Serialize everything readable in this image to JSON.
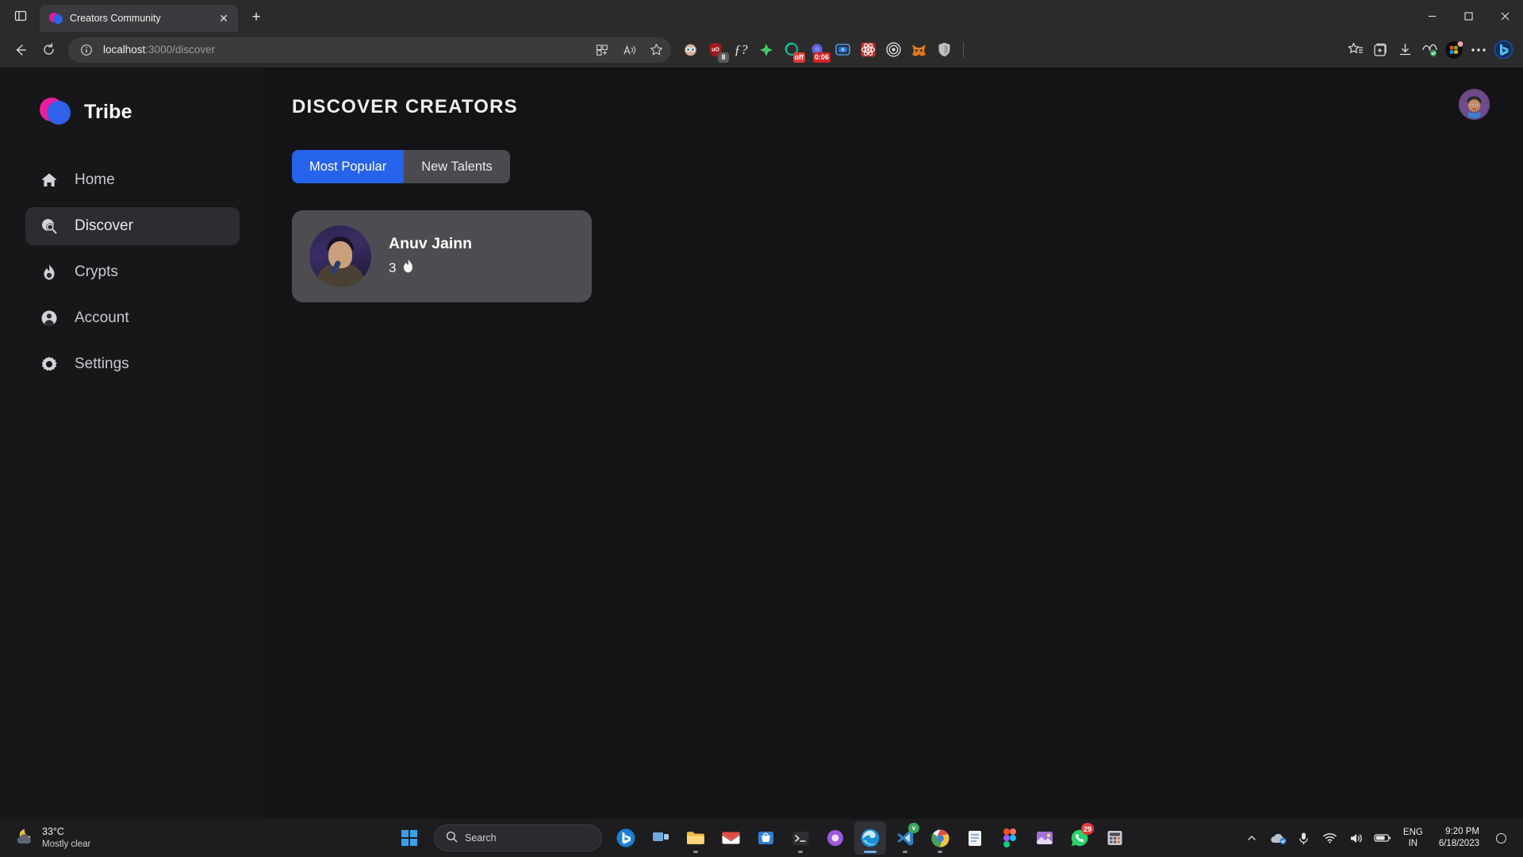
{
  "browser": {
    "tab": {
      "title": "Creators Community",
      "favicon": "tribe-logo-icon",
      "close_label": "✕"
    },
    "new_tab_label": "+",
    "sidebar_toggle": "tab-actions-icon",
    "window_controls": {
      "minimize": "−",
      "maximize": "☐",
      "close": "✕"
    },
    "nav": {
      "back": "←",
      "refresh": "↻"
    },
    "address": {
      "host": "localhost",
      "path": ":3000/discover",
      "info_icon": "info-icon"
    },
    "omnibox_actions": [
      {
        "name": "split-screen-icon",
        "glyph": "⊞"
      },
      {
        "name": "read-aloud-icon",
        "glyph": "A"
      },
      {
        "name": "favorite-star-icon",
        "glyph": "☆"
      }
    ],
    "extensions": [
      {
        "name": "grammarly-extension",
        "glyph": "◉",
        "color": "#d7b49a",
        "badge": "",
        "badge_color": ""
      },
      {
        "name": "ublock-origin-extension",
        "glyph": "uO",
        "color": "#a01b1b",
        "badge": "8",
        "badge_color": "#5a5a5a"
      },
      {
        "name": "wolfram-extension",
        "glyph": "ƒ?",
        "color": "#e8e8e8",
        "badge": "",
        "badge_color": ""
      },
      {
        "name": "color-picker-extension",
        "glyph": "✸",
        "color": "#6fc3e8",
        "badge": "",
        "badge_color": ""
      },
      {
        "name": "screen-recorder-extension",
        "glyph": "◔",
        "color": "#1ba98a",
        "badge": "off",
        "badge_color": "#e03a3a"
      },
      {
        "name": "loom-extension",
        "glyph": "◕",
        "color": "#5b5fd8",
        "badge": "0:06",
        "badge_color": "#d42323"
      },
      {
        "name": "video-downloader-extension",
        "glyph": "▣",
        "color": "#3b82f6",
        "badge": "",
        "badge_color": ""
      },
      {
        "name": "react-devtools-extension",
        "glyph": "⚛",
        "color": "#c03030",
        "badge": "",
        "badge_color": ""
      },
      {
        "name": "target-extension",
        "glyph": "◎",
        "color": "#dcdcdc",
        "badge": "",
        "badge_color": ""
      },
      {
        "name": "metamask-extension",
        "glyph": "🦊",
        "color": "#e2761b",
        "badge": "",
        "badge_color": ""
      },
      {
        "name": "shield-privacy-extension",
        "glyph": "⛨",
        "color": "#bfbfbf",
        "badge": "",
        "badge_color": ""
      }
    ],
    "toolbar_right": [
      {
        "name": "favorites-icon",
        "glyph": "☆"
      },
      {
        "name": "collections-icon",
        "glyph": "❐"
      },
      {
        "name": "downloads-icon",
        "glyph": "↓"
      },
      {
        "name": "browser-essentials-icon",
        "glyph": "♡"
      },
      {
        "name": "microsoft-rewards-icon",
        "glyph": "⊞"
      },
      {
        "name": "settings-more-icon",
        "glyph": "⋯"
      },
      {
        "name": "copilot-bing-icon",
        "glyph": "b"
      }
    ]
  },
  "app": {
    "brand": {
      "name": "Tribe",
      "logo": "tribe-logo-icon"
    },
    "sidebar": {
      "items": [
        {
          "label": "Home",
          "icon": "home-icon",
          "active": false
        },
        {
          "label": "Discover",
          "icon": "discover-search-icon",
          "active": true
        },
        {
          "label": "Crypts",
          "icon": "flame-icon",
          "active": false
        },
        {
          "label": "Account",
          "icon": "person-circle-icon",
          "active": false
        },
        {
          "label": "Settings",
          "icon": "gear-icon",
          "active": false
        }
      ]
    },
    "main": {
      "title": "DISCOVER CREATORS",
      "user_avatar": "user-avatar-icon",
      "tabs": [
        {
          "label": "Most Popular",
          "active": true
        },
        {
          "label": "New Talents",
          "active": false
        }
      ],
      "creators": [
        {
          "name": "Anuv Jainn",
          "count": "3",
          "fire_icon": "fire-icon"
        }
      ]
    },
    "colors": {
      "accent": "#2563eb",
      "card": "#4d4d51",
      "sidebar": "#17171a",
      "page": "#141417"
    }
  },
  "taskbar": {
    "weather": {
      "temp": "33°C",
      "desc": "Mostly clear",
      "icon": "moon-cloud-icon"
    },
    "start_label": "start-icon",
    "search_placeholder": "Search",
    "apps": [
      {
        "name": "bing-chat-taskbar",
        "glyph": "b",
        "color": "#1a7fd4",
        "badge": "",
        "state": ""
      },
      {
        "name": "task-view-taskbar",
        "glyph": "▤",
        "color": "#6fa8dc",
        "badge": "",
        "state": ""
      },
      {
        "name": "file-explorer-taskbar",
        "glyph": "📁",
        "color": "#f3b942",
        "badge": "",
        "state": "open"
      },
      {
        "name": "gmail-taskbar",
        "glyph": "M",
        "color": "#e04a3f",
        "badge": "",
        "state": ""
      },
      {
        "name": "microsoft-store-taskbar",
        "glyph": "⊞",
        "color": "#4f9fe0",
        "badge": "",
        "state": ""
      },
      {
        "name": "terminal-taskbar",
        "glyph": "⌫",
        "color": "#2f2f33",
        "badge": "",
        "state": "open"
      },
      {
        "name": "postman-taskbar",
        "glyph": "◉",
        "color": "#9b59e0",
        "badge": "",
        "state": ""
      },
      {
        "name": "edge-taskbar",
        "glyph": "e",
        "color": "#3b9ae1",
        "badge": "",
        "state": "active"
      },
      {
        "name": "vscode-taskbar",
        "glyph": "✂",
        "color": "#2f82c4",
        "badge": "",
        "state": "open"
      },
      {
        "name": "chrome-taskbar",
        "glyph": "◉",
        "color": "#4aa15a",
        "badge": "",
        "state": "open"
      },
      {
        "name": "notepad-taskbar",
        "glyph": "☰",
        "color": "#d8d8d8",
        "badge": "",
        "state": ""
      },
      {
        "name": "figma-taskbar",
        "glyph": "F",
        "color": "#d6456a",
        "badge": "",
        "state": ""
      },
      {
        "name": "photos-taskbar",
        "glyph": "◱",
        "color": "#a070d8",
        "badge": "",
        "state": ""
      },
      {
        "name": "whatsapp-taskbar",
        "glyph": "✆",
        "color": "#25d366",
        "badge": "29",
        "state": ""
      },
      {
        "name": "calculator-taskbar",
        "glyph": "▦",
        "color": "#c0c0c8",
        "badge": "",
        "state": ""
      }
    ],
    "tray": [
      {
        "name": "show-hidden-icons",
        "glyph": "⌃"
      },
      {
        "name": "onedrive-icon",
        "glyph": "☁"
      },
      {
        "name": "microphone-icon",
        "glyph": "🎤"
      },
      {
        "name": "wifi-icon",
        "glyph": "◠"
      },
      {
        "name": "volume-icon",
        "glyph": "🔊"
      },
      {
        "name": "battery-icon",
        "glyph": "▭"
      }
    ],
    "language": {
      "line1": "ENG",
      "line2": "IN"
    },
    "clock": {
      "time": "9:20 PM",
      "date": "6/18/2023"
    }
  }
}
